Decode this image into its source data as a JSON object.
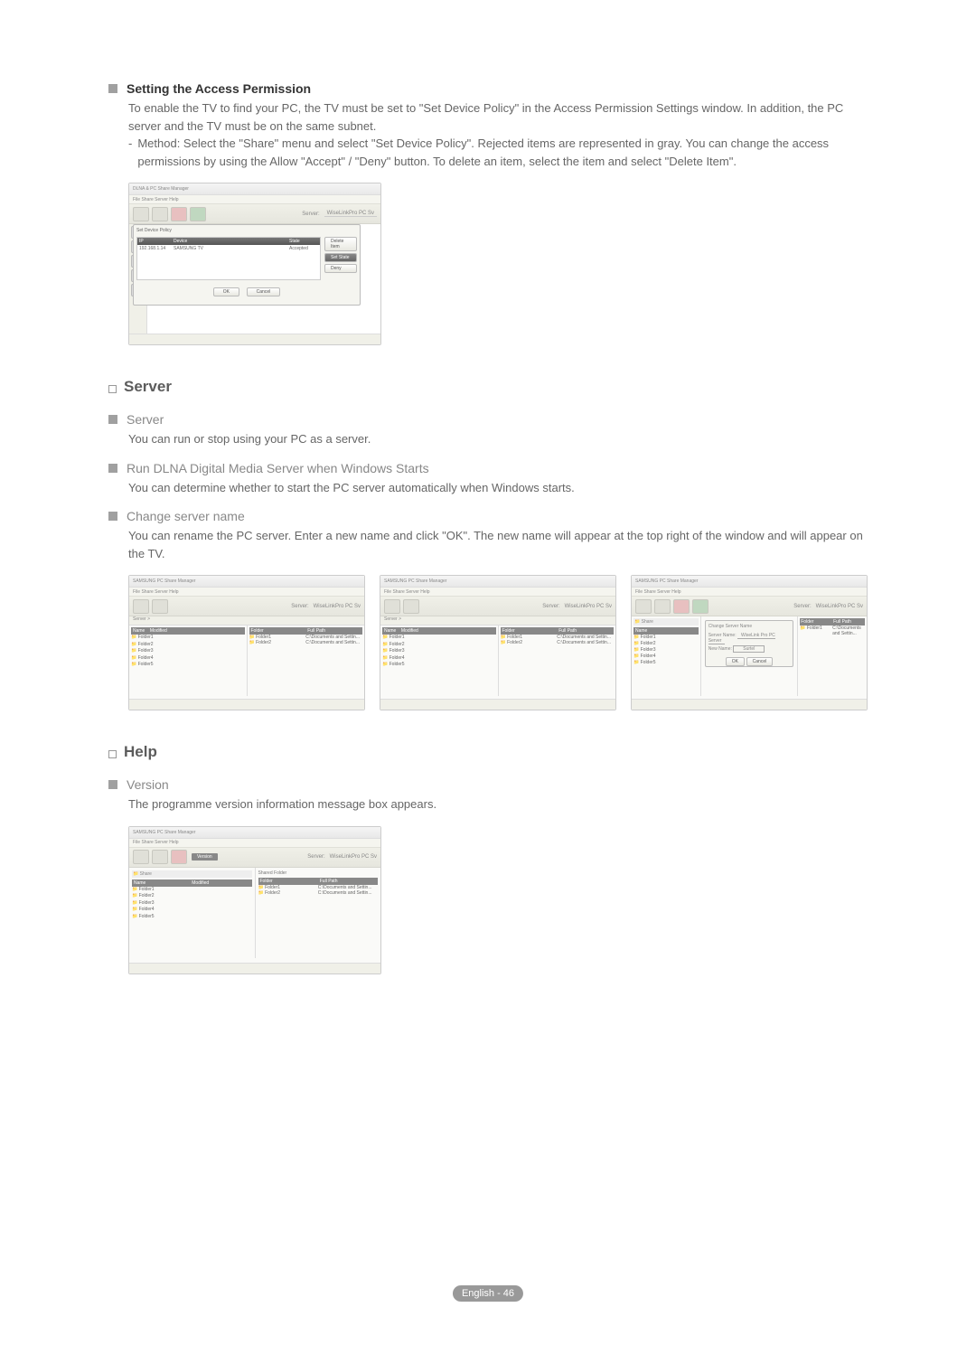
{
  "access": {
    "title": "Setting the Access Permission",
    "p1": "To enable the TV to find your PC, the TV must be set to \"Set Device Policy\" in the Access Permission Settings window. In addition, the PC server and the TV must be on the same subnet.",
    "p2": "Method: Select the \"Share\" menu and select \"Set Device Policy\". Rejected items are represented in gray. You can change the access permissions by using the Allow \"Accept\" / \"Deny\" button. To delete an item, select the item and select \"Delete Item\"."
  },
  "shot1": {
    "title": "DLNA & PC Share Manager",
    "menu": "File   Share   Server   Help",
    "server_label": "Server:",
    "server_value": "WiseLinkPro PC Sv",
    "dlg_title": "Set Device Policy",
    "col_ip": "IP",
    "col_device": "Device",
    "col_state": "State",
    "ip": "192.168.1.14",
    "device": "SAMSUNG TV",
    "state": "Accepted",
    "btn_delete": "Delete Item",
    "btn_setstate": "Set State",
    "btn_deny": "Deny",
    "btn_ok": "OK",
    "btn_cancel": "Cancel"
  },
  "server": {
    "heading": "Server",
    "i1_title": "Server",
    "i1_text": "You can run or stop using your PC as a server.",
    "i2_title": "Run DLNA Digital Media Server when Windows Starts",
    "i2_text": "You can determine whether to start the PC server automatically when Windows starts.",
    "i3_title": "Change server name",
    "i3_text": "You can rename the PC server. Enter a new name and click \"OK\". The new name will appear at the top right of the window and will appear on the TV."
  },
  "shot2_label_change": "Change Server Name",
  "shot2_path": "C:\\Documents and Settin...",
  "help": {
    "heading": "Help",
    "i1_title": "Version",
    "i1_text": "The programme version information message box appears."
  },
  "footer": "English - 46"
}
